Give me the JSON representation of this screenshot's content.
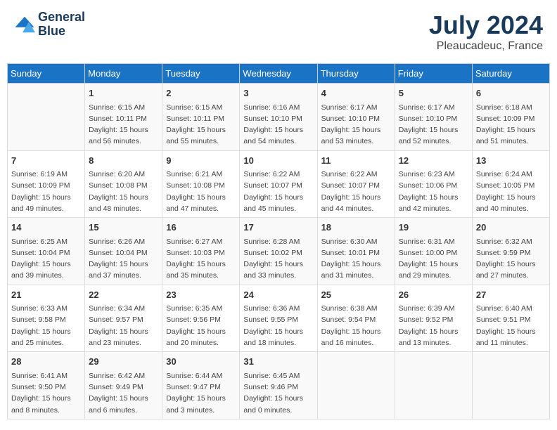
{
  "header": {
    "logo_line1": "General",
    "logo_line2": "Blue",
    "month_year": "July 2024",
    "location": "Pleaucadeuc, France"
  },
  "days_of_week": [
    "Sunday",
    "Monday",
    "Tuesday",
    "Wednesday",
    "Thursday",
    "Friday",
    "Saturday"
  ],
  "weeks": [
    [
      {
        "day": "",
        "content": ""
      },
      {
        "day": "1",
        "content": "Sunrise: 6:15 AM\nSunset: 10:11 PM\nDaylight: 15 hours\nand 56 minutes."
      },
      {
        "day": "2",
        "content": "Sunrise: 6:15 AM\nSunset: 10:11 PM\nDaylight: 15 hours\nand 55 minutes."
      },
      {
        "day": "3",
        "content": "Sunrise: 6:16 AM\nSunset: 10:10 PM\nDaylight: 15 hours\nand 54 minutes."
      },
      {
        "day": "4",
        "content": "Sunrise: 6:17 AM\nSunset: 10:10 PM\nDaylight: 15 hours\nand 53 minutes."
      },
      {
        "day": "5",
        "content": "Sunrise: 6:17 AM\nSunset: 10:10 PM\nDaylight: 15 hours\nand 52 minutes."
      },
      {
        "day": "6",
        "content": "Sunrise: 6:18 AM\nSunset: 10:09 PM\nDaylight: 15 hours\nand 51 minutes."
      }
    ],
    [
      {
        "day": "7",
        "content": "Sunrise: 6:19 AM\nSunset: 10:09 PM\nDaylight: 15 hours\nand 49 minutes."
      },
      {
        "day": "8",
        "content": "Sunrise: 6:20 AM\nSunset: 10:08 PM\nDaylight: 15 hours\nand 48 minutes."
      },
      {
        "day": "9",
        "content": "Sunrise: 6:21 AM\nSunset: 10:08 PM\nDaylight: 15 hours\nand 47 minutes."
      },
      {
        "day": "10",
        "content": "Sunrise: 6:22 AM\nSunset: 10:07 PM\nDaylight: 15 hours\nand 45 minutes."
      },
      {
        "day": "11",
        "content": "Sunrise: 6:22 AM\nSunset: 10:07 PM\nDaylight: 15 hours\nand 44 minutes."
      },
      {
        "day": "12",
        "content": "Sunrise: 6:23 AM\nSunset: 10:06 PM\nDaylight: 15 hours\nand 42 minutes."
      },
      {
        "day": "13",
        "content": "Sunrise: 6:24 AM\nSunset: 10:05 PM\nDaylight: 15 hours\nand 40 minutes."
      }
    ],
    [
      {
        "day": "14",
        "content": "Sunrise: 6:25 AM\nSunset: 10:04 PM\nDaylight: 15 hours\nand 39 minutes."
      },
      {
        "day": "15",
        "content": "Sunrise: 6:26 AM\nSunset: 10:04 PM\nDaylight: 15 hours\nand 37 minutes."
      },
      {
        "day": "16",
        "content": "Sunrise: 6:27 AM\nSunset: 10:03 PM\nDaylight: 15 hours\nand 35 minutes."
      },
      {
        "day": "17",
        "content": "Sunrise: 6:28 AM\nSunset: 10:02 PM\nDaylight: 15 hours\nand 33 minutes."
      },
      {
        "day": "18",
        "content": "Sunrise: 6:30 AM\nSunset: 10:01 PM\nDaylight: 15 hours\nand 31 minutes."
      },
      {
        "day": "19",
        "content": "Sunrise: 6:31 AM\nSunset: 10:00 PM\nDaylight: 15 hours\nand 29 minutes."
      },
      {
        "day": "20",
        "content": "Sunrise: 6:32 AM\nSunset: 9:59 PM\nDaylight: 15 hours\nand 27 minutes."
      }
    ],
    [
      {
        "day": "21",
        "content": "Sunrise: 6:33 AM\nSunset: 9:58 PM\nDaylight: 15 hours\nand 25 minutes."
      },
      {
        "day": "22",
        "content": "Sunrise: 6:34 AM\nSunset: 9:57 PM\nDaylight: 15 hours\nand 23 minutes."
      },
      {
        "day": "23",
        "content": "Sunrise: 6:35 AM\nSunset: 9:56 PM\nDaylight: 15 hours\nand 20 minutes."
      },
      {
        "day": "24",
        "content": "Sunrise: 6:36 AM\nSunset: 9:55 PM\nDaylight: 15 hours\nand 18 minutes."
      },
      {
        "day": "25",
        "content": "Sunrise: 6:38 AM\nSunset: 9:54 PM\nDaylight: 15 hours\nand 16 minutes."
      },
      {
        "day": "26",
        "content": "Sunrise: 6:39 AM\nSunset: 9:52 PM\nDaylight: 15 hours\nand 13 minutes."
      },
      {
        "day": "27",
        "content": "Sunrise: 6:40 AM\nSunset: 9:51 PM\nDaylight: 15 hours\nand 11 minutes."
      }
    ],
    [
      {
        "day": "28",
        "content": "Sunrise: 6:41 AM\nSunset: 9:50 PM\nDaylight: 15 hours\nand 8 minutes."
      },
      {
        "day": "29",
        "content": "Sunrise: 6:42 AM\nSunset: 9:49 PM\nDaylight: 15 hours\nand 6 minutes."
      },
      {
        "day": "30",
        "content": "Sunrise: 6:44 AM\nSunset: 9:47 PM\nDaylight: 15 hours\nand 3 minutes."
      },
      {
        "day": "31",
        "content": "Sunrise: 6:45 AM\nSunset: 9:46 PM\nDaylight: 15 hours\nand 0 minutes."
      },
      {
        "day": "",
        "content": ""
      },
      {
        "day": "",
        "content": ""
      },
      {
        "day": "",
        "content": ""
      }
    ]
  ]
}
